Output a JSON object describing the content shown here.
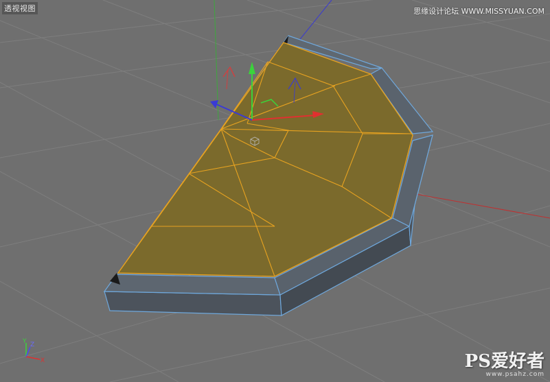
{
  "viewport": {
    "title": "透视视图"
  },
  "watermark": {
    "text": "思缘设计论坛 WWW.MISSYUAN.COM"
  },
  "logo": {
    "main": "PS爱好者",
    "sub": "www.psahz.com"
  },
  "gizmo": {
    "x_label": "X",
    "y_label": "Y",
    "z_label": "Z"
  },
  "colors": {
    "background": "#6e6e6e",
    "grid": "#7d7d7d",
    "selected_face": "#7a6a2e",
    "face_edge": "#e8a320",
    "mesh_edge": "#6fa8dc",
    "side": "#4e5660"
  }
}
